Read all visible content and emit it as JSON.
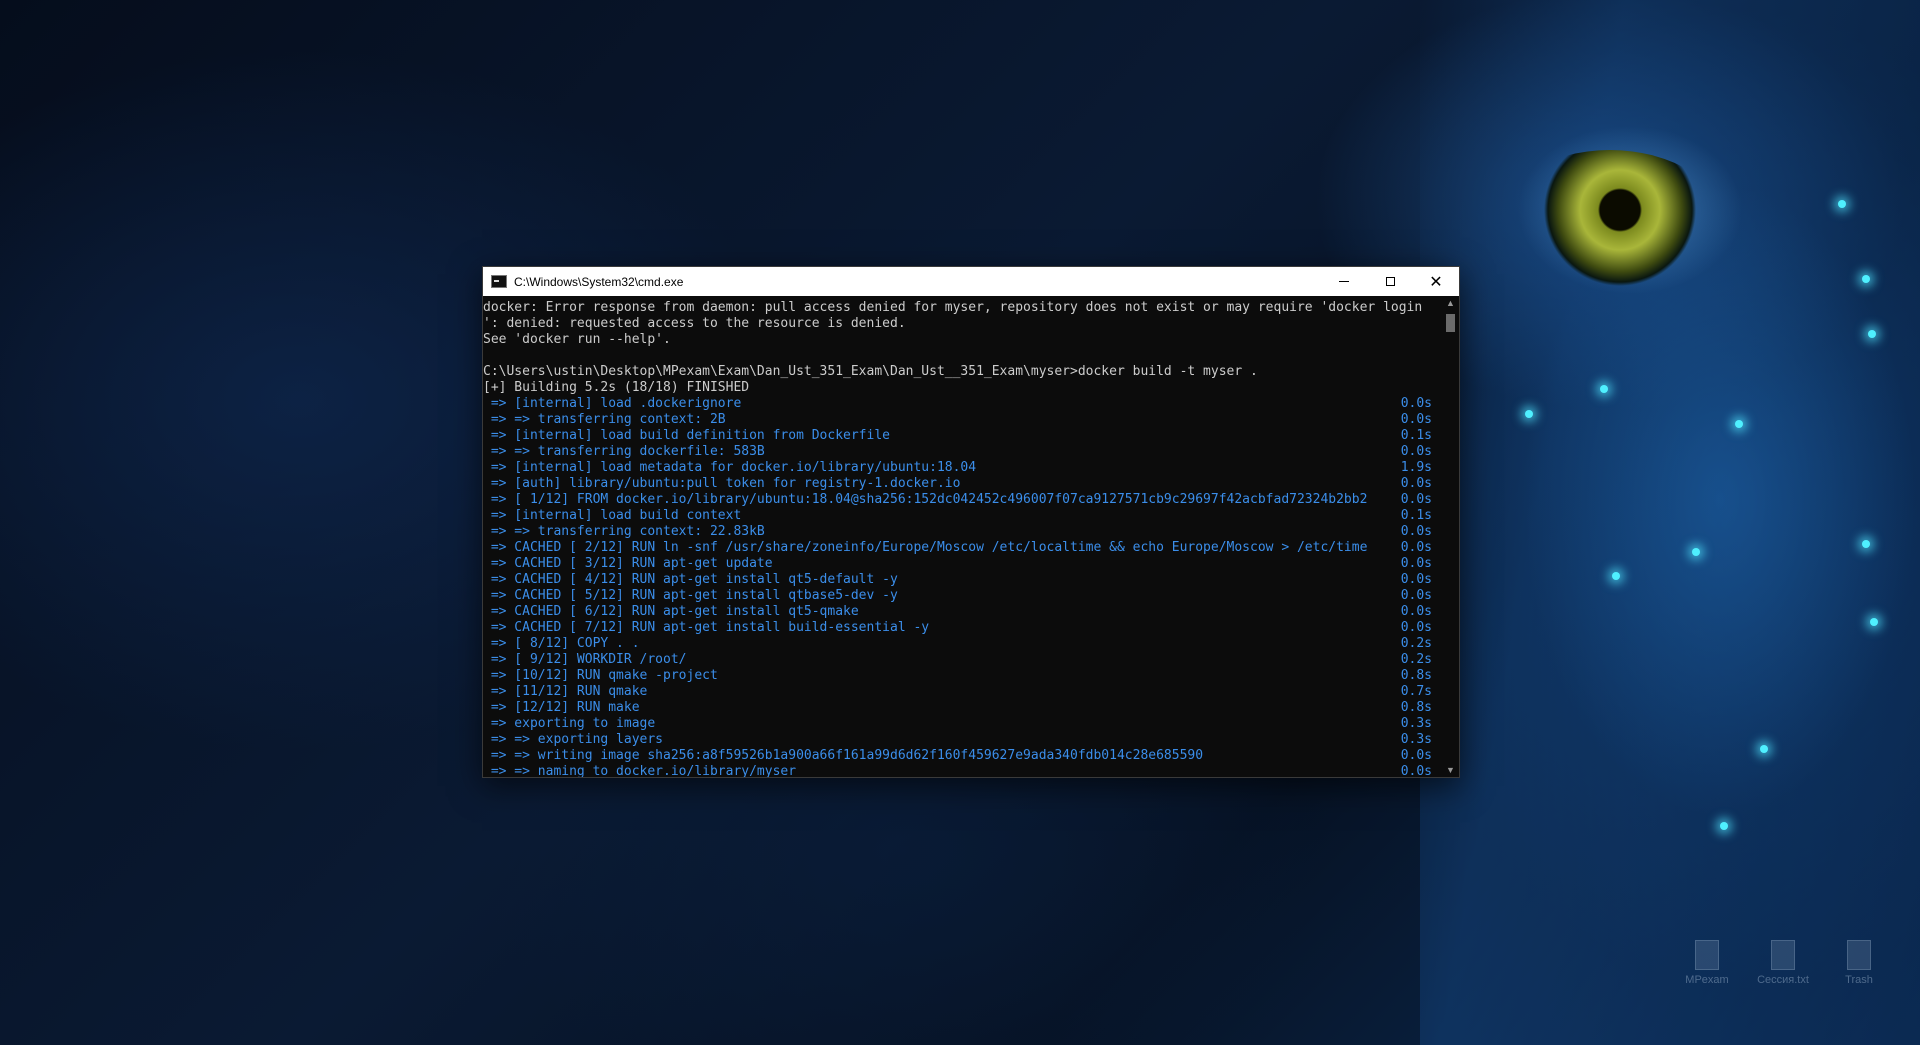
{
  "window": {
    "title": "C:\\Windows\\System32\\cmd.exe",
    "minimize_label": "",
    "maximize_label": "",
    "close_label": "✕"
  },
  "console": {
    "pre_lines": [
      "docker: Error response from daemon: pull access denied for myser, repository does not exist or may require 'docker login",
      "': denied: requested access to the resource is denied.",
      "See 'docker run --help'.",
      "",
      "C:\\Users\\ustin\\Desktop\\MPexam\\Exam\\Dan_Ust_351_Exam\\Dan_Ust__351_Exam\\myser>docker build -t myser .",
      "[+] Building 5.2s (18/18) FINISHED"
    ],
    "build_lines": [
      {
        "text": " => [internal] load .dockerignore",
        "time": "0.0s"
      },
      {
        "text": " => => transferring context: 2B",
        "time": "0.0s"
      },
      {
        "text": " => [internal] load build definition from Dockerfile",
        "time": "0.1s"
      },
      {
        "text": " => => transferring dockerfile: 583B",
        "time": "0.0s"
      },
      {
        "text": " => [internal] load metadata for docker.io/library/ubuntu:18.04",
        "time": "1.9s"
      },
      {
        "text": " => [auth] library/ubuntu:pull token for registry-1.docker.io",
        "time": "0.0s"
      },
      {
        "text": " => [ 1/12] FROM docker.io/library/ubuntu:18.04@sha256:152dc042452c496007f07ca9127571cb9c29697f42acbfad72324b2bb2",
        "time": "0.0s"
      },
      {
        "text": " => [internal] load build context",
        "time": "0.1s"
      },
      {
        "text": " => => transferring context: 22.83kB",
        "time": "0.0s"
      },
      {
        "text": " => CACHED [ 2/12] RUN ln -snf /usr/share/zoneinfo/Europe/Moscow /etc/localtime && echo Europe/Moscow > /etc/time",
        "time": "0.0s"
      },
      {
        "text": " => CACHED [ 3/12] RUN apt-get update",
        "time": "0.0s"
      },
      {
        "text": " => CACHED [ 4/12] RUN apt-get install qt5-default -y",
        "time": "0.0s"
      },
      {
        "text": " => CACHED [ 5/12] RUN apt-get install qtbase5-dev -y",
        "time": "0.0s"
      },
      {
        "text": " => CACHED [ 6/12] RUN apt-get install qt5-qmake",
        "time": "0.0s"
      },
      {
        "text": " => CACHED [ 7/12] RUN apt-get install build-essential -y",
        "time": "0.0s"
      },
      {
        "text": " => [ 8/12] COPY . .",
        "time": "0.2s"
      },
      {
        "text": " => [ 9/12] WORKDIR /root/",
        "time": "0.2s"
      },
      {
        "text": " => [10/12] RUN qmake -project",
        "time": "0.8s"
      },
      {
        "text": " => [11/12] RUN qmake",
        "time": "0.7s"
      },
      {
        "text": " => [12/12] RUN make",
        "time": "0.8s"
      },
      {
        "text": " => exporting to image",
        "time": "0.3s"
      },
      {
        "text": " => => exporting layers",
        "time": "0.3s"
      },
      {
        "text": " => => writing image sha256:a8f59526b1a900a66f161a99d6d62f160f459627e9ada340fdb014c28e685590",
        "time": "0.0s"
      },
      {
        "text": " => => naming to docker.io/library/myser",
        "time": "0.0s"
      }
    ]
  },
  "desktop_icons": [
    {
      "label": "MPexam"
    },
    {
      "label": "Сессия.txt"
    },
    {
      "label": "Trash"
    }
  ],
  "colors": {
    "console_bg": "#0c0c0c",
    "console_text": "#cccccc",
    "build_text": "#3b8eea"
  }
}
